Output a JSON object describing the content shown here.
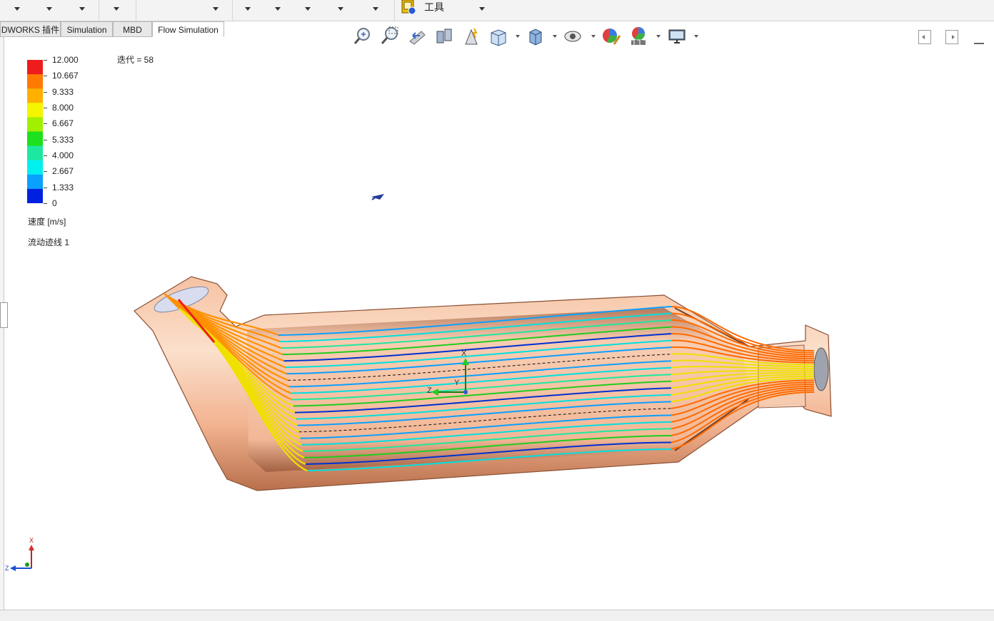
{
  "toolbar": {
    "tools_label": "工具",
    "icons": [
      "tools-app-icon"
    ]
  },
  "tabs": [
    {
      "label": "DWORKS 插件"
    },
    {
      "label": "Simulation"
    },
    {
      "label": "MBD"
    },
    {
      "label": "Flow Simulation",
      "active": true
    }
  ],
  "view_tools": [
    "zoom-to-fit-icon",
    "zoom-to-area-icon",
    "previous-view-icon",
    "section-view-icon",
    "dynamic-annotation-icon",
    "view-orientation-icon",
    "display-style-icon",
    "hide-show-items-icon",
    "edit-appearance-icon",
    "apply-scene-icon",
    "view-settings-icon"
  ],
  "legend": {
    "ticks": [
      "12.000",
      "10.667",
      "9.333",
      "8.000",
      "6.667",
      "5.333",
      "4.000",
      "2.667",
      "1.333",
      "0"
    ],
    "colors": [
      "#ee1c1c",
      "#ff7a00",
      "#ffb000",
      "#f5f500",
      "#a0f000",
      "#1ee01e",
      "#1ee8a0",
      "#00f0f0",
      "#0aa0ff",
      "#0020e0"
    ],
    "unit": "速度 [m/s]",
    "plot_name": "流动迹线 1"
  },
  "iteration": "迭代 = 58",
  "triad": {
    "x": "X",
    "y": "Y",
    "z": "Z"
  }
}
